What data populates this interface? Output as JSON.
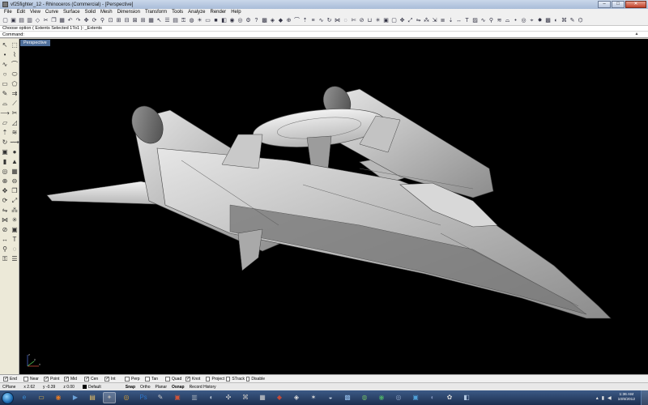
{
  "window": {
    "title": "vf25fighter_12 - Rhinoceros (Commercial) - [Perspective]",
    "controls": [
      "–",
      "□",
      "✕"
    ]
  },
  "menubar": [
    "File",
    "Edit",
    "View",
    "Curve",
    "Surface",
    "Solid",
    "Mesh",
    "Dimension",
    "Transform",
    "Tools",
    "Analyze",
    "Render",
    "Help"
  ],
  "toolbar_icons": [
    "new-icon",
    "open-icon",
    "save-icon",
    "print-icon",
    "import-icon",
    "cut-icon",
    "copy-icon",
    "paste-icon",
    "undo-icon",
    "redo-icon",
    "pan-icon",
    "rotate-view-icon",
    "zoom-icon",
    "zoom-window-icon",
    "zoom-extents-icon",
    "zoom-selected-icon",
    "zoom-all-icon",
    "four-viewports-icon",
    "grid-icon",
    "select-icon",
    "layers-icon",
    "properties-icon",
    "lock-icon",
    "lightbulb-icon",
    "sun-icon",
    "wireframe-icon",
    "shaded-icon",
    "rendered-icon",
    "render-icon",
    "material-icon",
    "options-icon",
    "help-icon",
    "mesh-icon",
    "surface-icon",
    "solid-icon",
    "boolean-icon",
    "fillet-icon",
    "extrude-icon",
    "loft-icon",
    "sweep-icon",
    "revolve-icon",
    "network-icon",
    "patch-icon",
    "trim-icon",
    "split-icon",
    "join-icon",
    "explode-icon",
    "group-icon",
    "ungroup-icon",
    "move-icon",
    "scale-icon",
    "mirror-icon",
    "array-icon",
    "orient-icon",
    "align-icon",
    "project-icon",
    "dimension-icon",
    "text-icon",
    "hatch-icon",
    "curve-icon",
    "analyze-icon",
    "zebra-icon",
    "curvature-icon",
    "point-icon",
    "osnap-icon",
    "camera-icon",
    "light-icon",
    "texture-icon",
    "environment-icon",
    "plugin-icon",
    "script-icon",
    "macro-icon"
  ],
  "command": {
    "history": "Choose option ( Extents  Selected  1To1 ): _Extents",
    "prompt_label": "Command:",
    "value": ""
  },
  "palette_icons": [
    "select-arrow-icon",
    "select-window-icon",
    "point-icon",
    "polyline-icon",
    "curve-icon",
    "arc-icon",
    "circle-icon",
    "ellipse-icon",
    "rectangle-icon",
    "polygon-icon",
    "freeform-icon",
    "offset-icon",
    "fillet-curve-icon",
    "chamfer-icon",
    "extend-icon",
    "trim-icon",
    "surface-plane-icon",
    "surface-corner-icon",
    "extrude-icon",
    "loft-icon",
    "revolve-icon",
    "sweep-icon",
    "box-icon",
    "sphere-icon",
    "cylinder-icon",
    "cone-icon",
    "torus-icon",
    "mesh-icon",
    "boolean-union-icon",
    "boolean-diff-icon",
    "move-icon",
    "copy-icon",
    "rotate-icon",
    "scale-icon",
    "mirror-icon",
    "array-icon",
    "join-icon",
    "explode-icon",
    "split-icon",
    "group-icon",
    "dimension-icon",
    "text-icon",
    "analyze-icon",
    "hide-icon",
    "lock-icon",
    "layer-icon"
  ],
  "viewport": {
    "name": "Perspective",
    "axes": {
      "x": "x",
      "y": "y",
      "z": "z"
    }
  },
  "osnap": [
    {
      "label": "End",
      "checked": true
    },
    {
      "label": "Near",
      "checked": false
    },
    {
      "label": "Point",
      "checked": true
    },
    {
      "label": "Mid",
      "checked": true
    },
    {
      "label": "Cen",
      "checked": true
    },
    {
      "label": "Int",
      "checked": true
    },
    {
      "label": "Perp",
      "checked": false
    },
    {
      "label": "Tan",
      "checked": false
    },
    {
      "label": "Quad",
      "checked": false
    },
    {
      "label": "Knot",
      "checked": true
    },
    {
      "label": "Project",
      "checked": false
    },
    {
      "label": "STrack",
      "checked": false
    },
    {
      "label": "Disable",
      "checked": false
    }
  ],
  "statusbar": {
    "cplane": "CPlane",
    "x": "x 2.62",
    "y": "y -0.39",
    "z": "z 0.00",
    "layer": "Default",
    "layer_color": "#000000",
    "toggles": [
      {
        "label": "Snap",
        "active": true
      },
      {
        "label": "Ortho",
        "active": false
      },
      {
        "label": "Planar",
        "active": false
      },
      {
        "label": "Osnap",
        "active": true
      },
      {
        "label": "Record History",
        "active": false
      }
    ]
  },
  "taskbar": {
    "apps": [
      {
        "name": "ie-icon",
        "glyph": "e",
        "color": "#3a8fd8",
        "active": false
      },
      {
        "name": "explorer-icon",
        "glyph": "▭",
        "color": "#e0b24a",
        "active": false
      },
      {
        "name": "firefox-icon",
        "glyph": "◉",
        "color": "#e47b28",
        "active": false
      },
      {
        "name": "media-icon",
        "glyph": "▶",
        "color": "#6aa1d8",
        "active": false
      },
      {
        "name": "folder-icon",
        "glyph": "▤",
        "color": "#e5c06a",
        "active": false
      },
      {
        "name": "rhino-icon",
        "glyph": "✦",
        "color": "#b0b0b0",
        "active": true
      },
      {
        "name": "chrome-icon",
        "glyph": "◎",
        "color": "#d8a23a",
        "active": false
      },
      {
        "name": "photoshop-icon",
        "glyph": "Ps",
        "color": "#2c74c8",
        "active": false
      },
      {
        "name": "paint-icon",
        "glyph": "✎",
        "color": "#c8c8c8",
        "active": false
      },
      {
        "name": "sketchup-icon",
        "glyph": "▣",
        "color": "#d0543a",
        "active": false
      },
      {
        "name": "app-icon-1",
        "glyph": "▥",
        "color": "#9aa6b5",
        "active": false
      },
      {
        "name": "app-icon-2",
        "glyph": "◐",
        "color": "#b7c4d4",
        "active": false
      },
      {
        "name": "app-icon-3",
        "glyph": "✣",
        "color": "#d6d6d6",
        "active": false
      },
      {
        "name": "app-icon-4",
        "glyph": "⌘",
        "color": "#c0c0c0",
        "active": false
      },
      {
        "name": "app-icon-5",
        "glyph": "▦",
        "color": "#d0d0d0",
        "active": false
      },
      {
        "name": "app-icon-6",
        "glyph": "◆",
        "color": "#c24a3a",
        "active": false
      },
      {
        "name": "app-icon-7",
        "glyph": "◈",
        "color": "#e0e0e0",
        "active": false
      },
      {
        "name": "app-icon-8",
        "glyph": "✶",
        "color": "#d7d7d7",
        "active": false
      },
      {
        "name": "app-icon-9",
        "glyph": "◒",
        "color": "#c8d6e6",
        "active": false
      },
      {
        "name": "app-icon-10",
        "glyph": "▩",
        "color": "#8fb9e6",
        "active": false
      },
      {
        "name": "app-icon-11",
        "glyph": "◍",
        "color": "#6db36a",
        "active": false
      },
      {
        "name": "app-icon-12",
        "glyph": "◉",
        "color": "#4aa86a",
        "active": false
      },
      {
        "name": "app-icon-13",
        "glyph": "◎",
        "color": "#8fa6c7",
        "active": false
      },
      {
        "name": "app-icon-14",
        "glyph": "▣",
        "color": "#4fa0d8",
        "active": false
      },
      {
        "name": "app-icon-15",
        "glyph": "◐",
        "color": "#7a8fb8",
        "active": false
      },
      {
        "name": "app-icon-16",
        "glyph": "✿",
        "color": "#d8d8d8",
        "active": false
      },
      {
        "name": "app-icon-17",
        "glyph": "◧",
        "color": "#b0c6e0",
        "active": false
      }
    ],
    "time": "1:36 AM",
    "date": "10/6/2012"
  }
}
